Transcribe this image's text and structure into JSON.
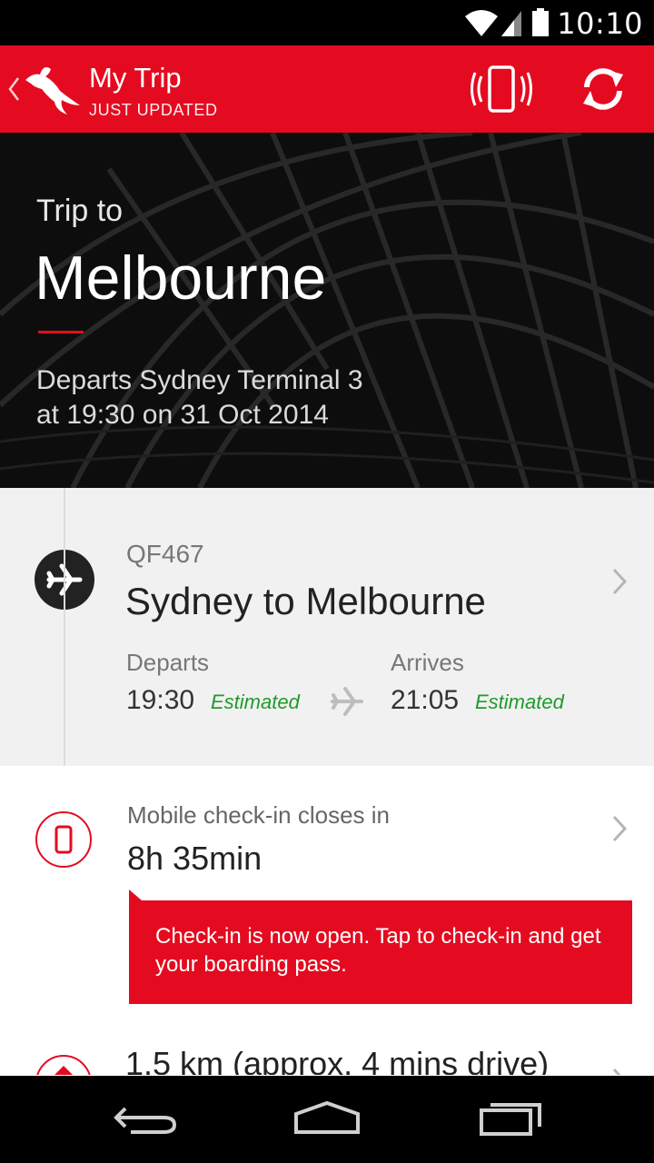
{
  "status_bar": {
    "time": "10:10",
    "icons": [
      "wifi-icon",
      "signal-icon",
      "battery-icon"
    ]
  },
  "app_bar": {
    "title": "My Trip",
    "subtitle": "JUST UPDATED"
  },
  "hero": {
    "trip_to_label": "Trip to",
    "destination": "Melbourne",
    "departs_line1": "Departs Sydney Terminal 3",
    "departs_line2": "at 19:30 on 31 Oct 2014"
  },
  "flight": {
    "number": "QF467",
    "route": "Sydney to Melbourne",
    "departs_label": "Departs",
    "departs_time": "19:30",
    "departs_status": "Estimated",
    "arrives_label": "Arrives",
    "arrives_time": "21:05",
    "arrives_status": "Estimated"
  },
  "checkin": {
    "label": "Mobile check-in closes in",
    "time_left": "8h 35min",
    "banner_text": "Check-in is now open. Tap to check-in and get your boarding pass."
  },
  "next_item": {
    "text": "1.5 km (approx. 4 mins drive)"
  },
  "colors": {
    "brand_red": "#e40b20",
    "status_green": "#1f9a2c"
  },
  "nav": {
    "buttons": [
      "back-nav-icon",
      "home-nav-icon",
      "recents-nav-icon"
    ]
  }
}
